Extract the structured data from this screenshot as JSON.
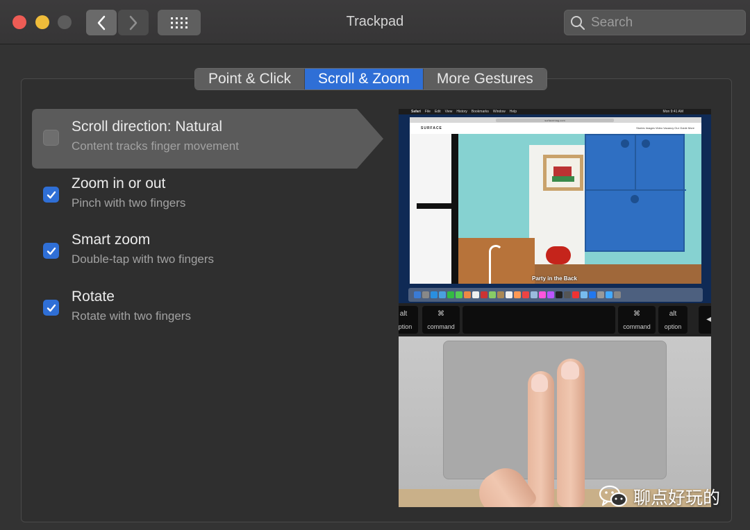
{
  "window": {
    "title": "Trackpad"
  },
  "toolbar": {
    "back_icon": "chevron-left-icon",
    "forward_icon": "chevron-right-icon",
    "grid_icon": "grid-icon"
  },
  "search": {
    "placeholder": "Search"
  },
  "tabs": [
    {
      "label": "Point & Click",
      "active": false
    },
    {
      "label": "Scroll & Zoom",
      "active": true
    },
    {
      "label": "More Gestures",
      "active": false
    }
  ],
  "options": [
    {
      "title": "Scroll direction: Natural",
      "subtitle": "Content tracks finger movement",
      "checked": false,
      "selected": true
    },
    {
      "title": "Zoom in or out",
      "subtitle": "Pinch with two fingers",
      "checked": true,
      "selected": false
    },
    {
      "title": "Smart zoom",
      "subtitle": "Double-tap with two fingers",
      "checked": true,
      "selected": false
    },
    {
      "title": "Rotate",
      "subtitle": "Rotate with two fingers",
      "checked": true,
      "selected": false
    }
  ],
  "preview": {
    "menubar": [
      "Safari",
      "File",
      "Edit",
      "View",
      "History",
      "Bookmarks",
      "Window",
      "Help"
    ],
    "menubar_time": "Mon 9:41 AM",
    "url": "surfacemag.com",
    "site_name": "SURFACE",
    "site_links": "Stories  Images  Video  Vacancy  Our Guide  More",
    "caption": "Party in the Back",
    "keys": {
      "left_option_top": "alt",
      "left_option": "option",
      "left_command_top": "⌘",
      "left_command": "command",
      "right_command_top": "⌘",
      "right_command": "command",
      "right_option_top": "alt",
      "right_option": "option",
      "arrow": "◀"
    }
  },
  "watermark": {
    "text": "聊点好玩的",
    "icon": "wechat-icon"
  },
  "colors": {
    "accent": "#2f6fd6",
    "close": "#ee5c55",
    "minimize": "#efbc3a",
    "zoom": "#5c5c5c"
  }
}
